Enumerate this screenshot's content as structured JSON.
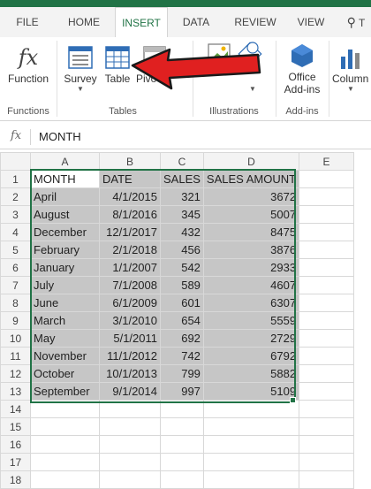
{
  "tabs": [
    "FILE",
    "HOME",
    "INSERT",
    "DATA",
    "REVIEW",
    "VIEW",
    "T"
  ],
  "active_tab": "INSERT",
  "ribbon": {
    "function_label": "Function",
    "survey_label": "Survey",
    "table_label": "Table",
    "pivot_label": "Pivo",
    "office_addins_label": [
      "Office",
      "Add-ins"
    ],
    "column_label": "Column",
    "groups": {
      "functions": "Functions",
      "tables": "Tables",
      "illustrations": "Illustrations",
      "addins": "Add-ins"
    }
  },
  "formula_bar": {
    "fx": "fx",
    "content": "MONTH"
  },
  "columns": [
    "A",
    "B",
    "C",
    "D",
    "E"
  ],
  "rows": [
    [
      "MONTH",
      "DATE",
      "SALES",
      "SALES AMOUNT"
    ],
    [
      "April",
      "4/1/2015",
      "321",
      "3672"
    ],
    [
      "August",
      "8/1/2016",
      "345",
      "5007"
    ],
    [
      "December",
      "12/1/2017",
      "432",
      "8475"
    ],
    [
      "February",
      "2/1/2018",
      "456",
      "3876"
    ],
    [
      "January",
      "1/1/2007",
      "542",
      "2933"
    ],
    [
      "July",
      "7/1/2008",
      "589",
      "4607"
    ],
    [
      "June",
      "6/1/2009",
      "601",
      "6307"
    ],
    [
      "March",
      "3/1/2010",
      "654",
      "5559"
    ],
    [
      "May",
      "5/1/2011",
      "692",
      "2729"
    ],
    [
      "November",
      "11/1/2012",
      "742",
      "6792"
    ],
    [
      "October",
      "10/1/2013",
      "799",
      "5882"
    ],
    [
      "September",
      "9/1/2014",
      "997",
      "5109"
    ]
  ],
  "row_numbers": [
    "1",
    "2",
    "3",
    "4",
    "5",
    "6",
    "7",
    "8",
    "9",
    "10",
    "11",
    "12",
    "13",
    "14",
    "15",
    "16",
    "17",
    "18"
  ],
  "colors": {
    "excel_green": "#217346",
    "arrow_red": "#e02020",
    "selection_gray": "#c6c6c6"
  }
}
